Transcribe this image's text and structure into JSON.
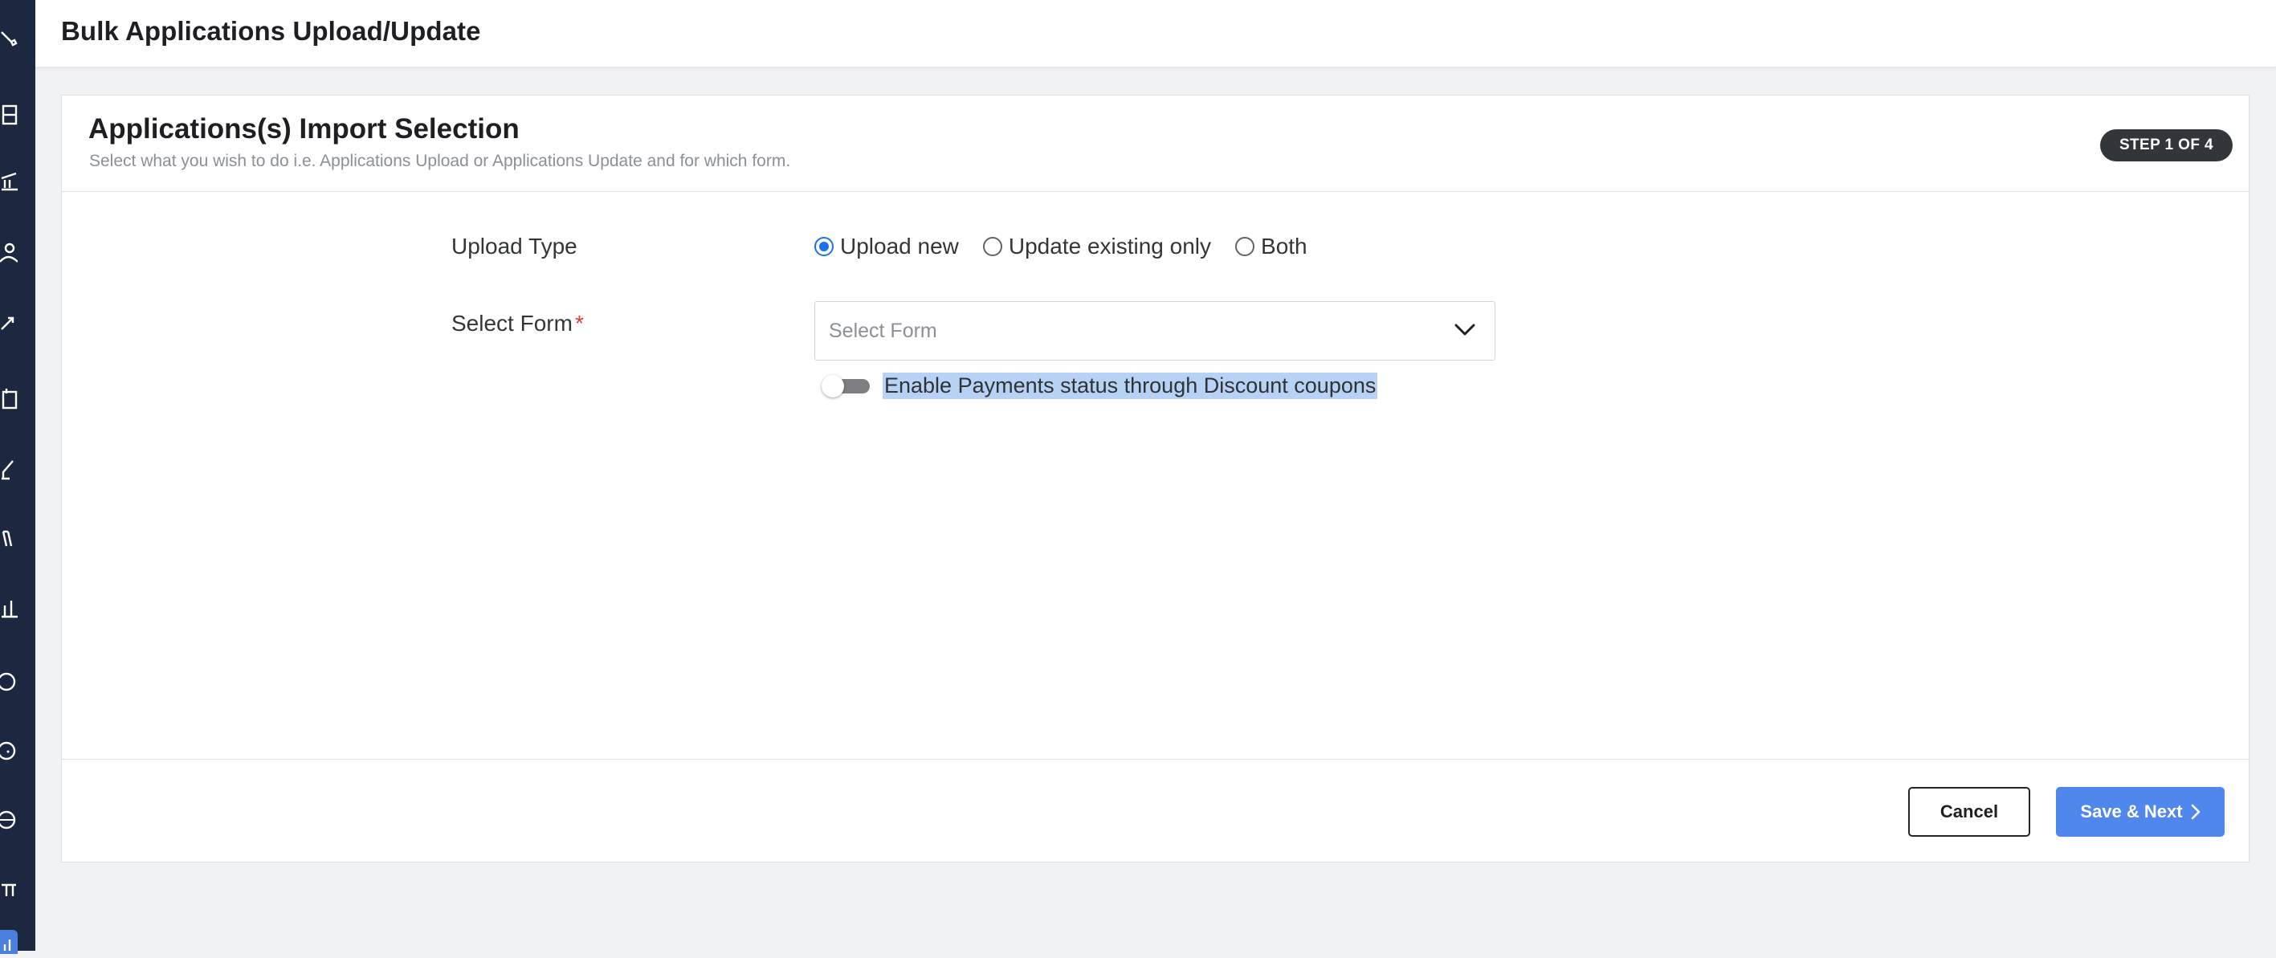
{
  "header": {
    "title": "Bulk Applications Upload/Update"
  },
  "sidebar": {
    "icons": [
      "wrench-icon",
      "layout-icon",
      "bank-icon",
      "user-icon",
      "trend-icon",
      "calendar-icon",
      "pen-icon",
      "book-icon",
      "chart-icon",
      "clock-icon",
      "help-icon",
      "globe-icon",
      "table-icon",
      "analytics-icon"
    ]
  },
  "card": {
    "title": "Applications(s) Import Selection",
    "subtitle": "Select what you wish to do i.e. Applications Upload or Applications Update and for which form.",
    "step_badge": "STEP 1 OF 4"
  },
  "form": {
    "upload_type_label": "Upload Type",
    "upload_type_options": [
      "Upload new",
      "Update existing only",
      "Both"
    ],
    "upload_type_selected": "Upload new",
    "select_form_label": "Select Form",
    "required_mark": "*",
    "select_form_placeholder": "Select Form",
    "toggle_label": "Enable Payments status through Discount coupons",
    "toggle_on": false
  },
  "footer": {
    "cancel_label": "Cancel",
    "save_next_label": "Save & Next"
  },
  "colors": {
    "sidebar_bg": "#1c2840",
    "primary_button": "#5087ec",
    "radio_checked": "#1a73e8",
    "step_badge_bg": "#32363b",
    "selection_highlight": "#b7d2f5"
  }
}
